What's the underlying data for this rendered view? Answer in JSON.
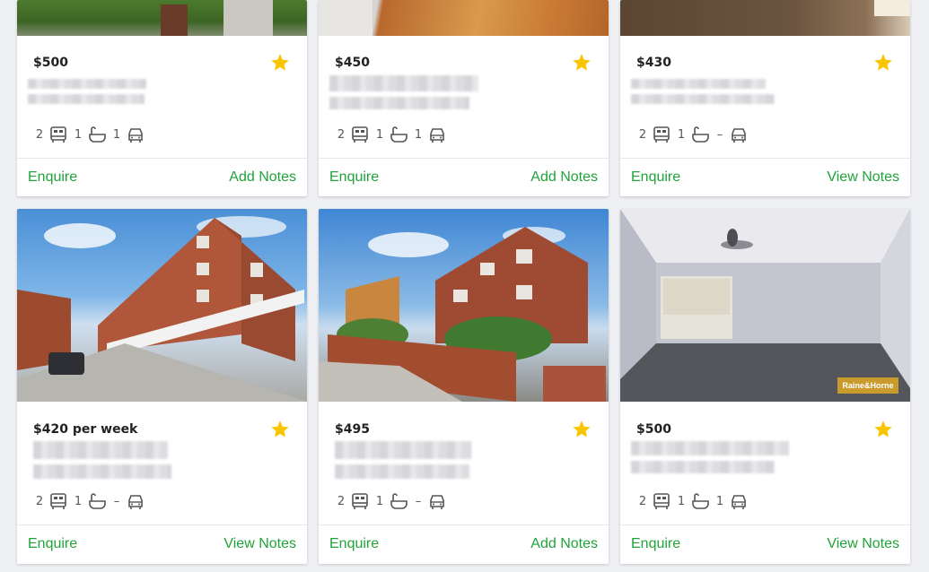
{
  "listings": [
    {
      "price": "$500",
      "beds": "2",
      "baths": "1",
      "cars": "1",
      "enquire": "Enquire",
      "notes": "Add Notes"
    },
    {
      "price": "$450",
      "beds": "2",
      "baths": "1",
      "cars": "1",
      "enquire": "Enquire",
      "notes": "Add Notes"
    },
    {
      "price": "$430",
      "beds": "2",
      "baths": "1",
      "cars": "–",
      "enquire": "Enquire",
      "notes": "View Notes"
    },
    {
      "price": "$420 per week",
      "beds": "2",
      "baths": "1",
      "cars": "–",
      "enquire": "Enquire",
      "notes": "View Notes"
    },
    {
      "price": "$495",
      "beds": "2",
      "baths": "1",
      "cars": "–",
      "enquire": "Enquire",
      "notes": "Add Notes"
    },
    {
      "price": "$500",
      "beds": "2",
      "baths": "1",
      "cars": "1",
      "enquire": "Enquire",
      "notes": "View Notes"
    }
  ],
  "watermark": "Raine&Horne",
  "colors": {
    "accent": "#1fa33a",
    "star": "#f7c600"
  }
}
